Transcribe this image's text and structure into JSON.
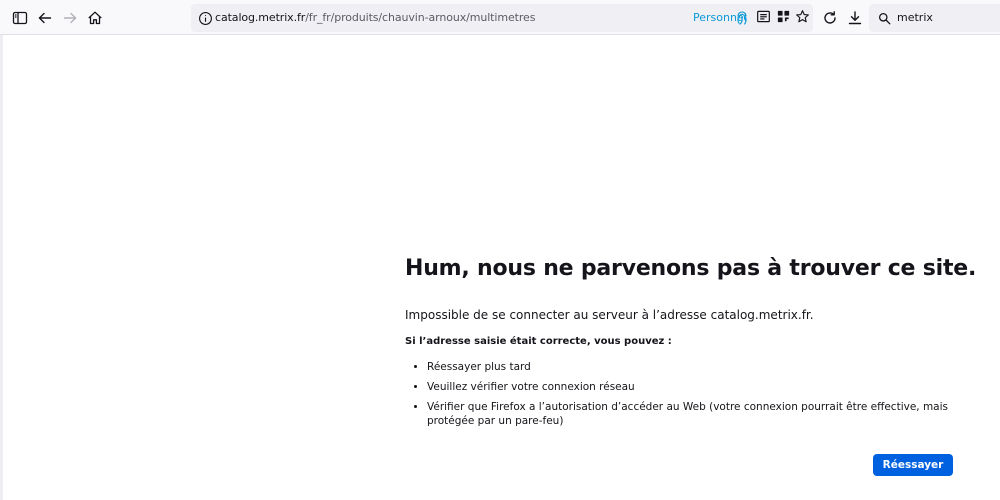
{
  "browser": {
    "url": {
      "host": "catalog.metrix.fr",
      "path": "/fr_fr/produits/chauvin-arnoux/multimetres"
    },
    "container_label": "Personnel",
    "container_color": "#0b9ad6",
    "search_value": "metrix",
    "icons": [
      "sidebar-icon",
      "back-arrow-icon",
      "forward-arrow-icon",
      "home-icon",
      "info-icon",
      "fingerprint-icon",
      "reader-mode-icon",
      "extensions-icon",
      "bookmark-star-icon",
      "reload-icon",
      "download-icon",
      "search-icon"
    ]
  },
  "error": {
    "title": "Hum, nous ne parvenons pas à trouver ce site.",
    "description": "Impossible de se connecter au serveur à l’adresse catalog.metrix.fr.",
    "subheading": "Si l’adresse saisie était correcte, vous pouvez :",
    "suggestions": [
      "Réessayer plus tard",
      "Veuillez vérifier votre connexion réseau",
      "Vérifier que Firefox a l’autorisation d’accéder au Web (votre connexion pourrait être effective, mais protégée par un pare-feu)"
    ],
    "retry_label": "Réessayer",
    "retry_color": "#0061e0"
  }
}
